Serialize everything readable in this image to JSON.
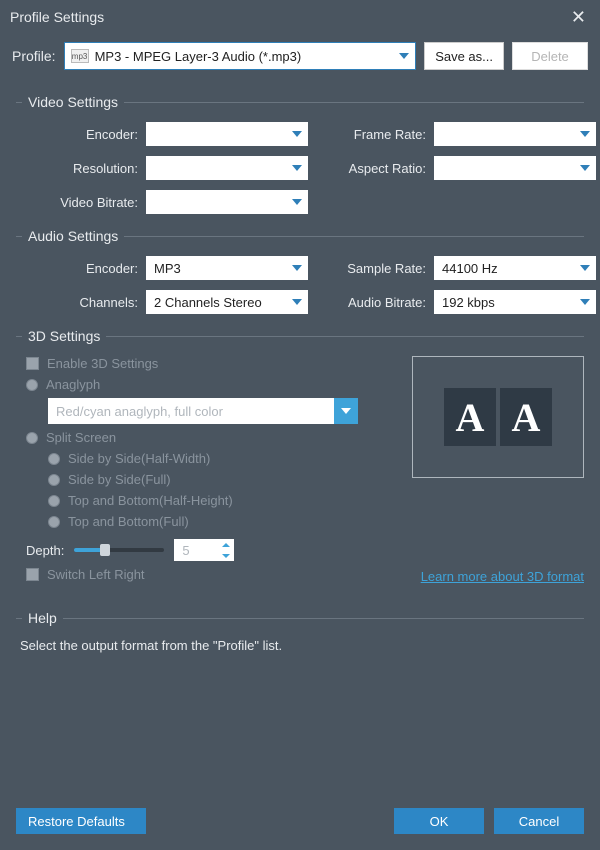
{
  "window": {
    "title": "Profile Settings"
  },
  "profile_row": {
    "label": "Profile:",
    "selected": "MP3 - MPEG Layer-3 Audio (*.mp3)",
    "icon_text": "mp3",
    "save_as": "Save as...",
    "delete": "Delete"
  },
  "video": {
    "title": "Video Settings",
    "encoder_label": "Encoder:",
    "encoder_value": "",
    "resolution_label": "Resolution:",
    "resolution_value": "",
    "video_bitrate_label": "Video Bitrate:",
    "video_bitrate_value": "",
    "frame_rate_label": "Frame Rate:",
    "frame_rate_value": "",
    "aspect_ratio_label": "Aspect Ratio:",
    "aspect_ratio_value": ""
  },
  "audio": {
    "title": "Audio Settings",
    "encoder_label": "Encoder:",
    "encoder_value": "MP3",
    "channels_label": "Channels:",
    "channels_value": "2 Channels Stereo",
    "sample_rate_label": "Sample Rate:",
    "sample_rate_value": "44100 Hz",
    "audio_bitrate_label": "Audio Bitrate:",
    "audio_bitrate_value": "192 kbps"
  },
  "three_d": {
    "title": "3D Settings",
    "enable_label": "Enable 3D Settings",
    "anaglyph_label": "Anaglyph",
    "anaglyph_select": "Red/cyan anaglyph, full color",
    "split_label": "Split Screen",
    "sbs_half": "Side by Side(Half-Width)",
    "sbs_full": "Side by Side(Full)",
    "tab_half": "Top and Bottom(Half-Height)",
    "tab_full": "Top and Bottom(Full)",
    "depth_label": "Depth:",
    "depth_value": "5",
    "switch_label": "Switch Left Right",
    "learn_more": "Learn more about 3D format",
    "preview_letter": "A"
  },
  "help": {
    "title": "Help",
    "text": "Select the output format from the \"Profile\" list."
  },
  "footer": {
    "restore": "Restore Defaults",
    "ok": "OK",
    "cancel": "Cancel"
  }
}
